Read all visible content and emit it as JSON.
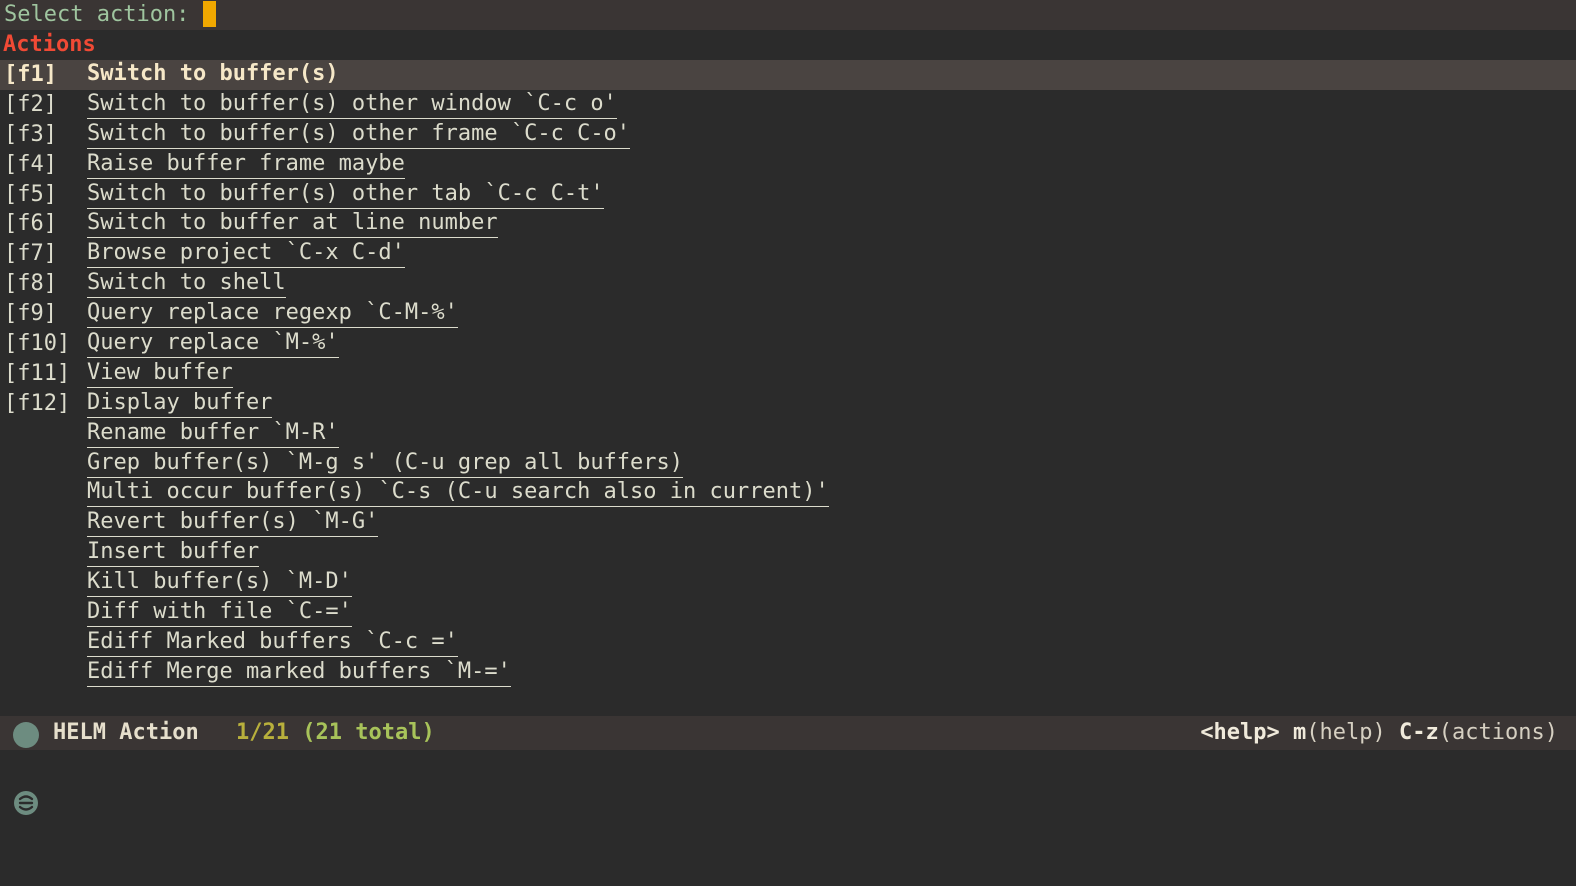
{
  "prompt": {
    "label": "Select action: "
  },
  "header": {
    "title": "Actions"
  },
  "actions": [
    {
      "key": "[f1]",
      "label": "Switch to buffer(s)"
    },
    {
      "key": "[f2]",
      "label": "Switch to buffer(s) other window `C-c o'"
    },
    {
      "key": "[f3]",
      "label": "Switch to buffer(s) other frame `C-c C-o'"
    },
    {
      "key": "[f4]",
      "label": "Raise buffer frame maybe"
    },
    {
      "key": "[f5]",
      "label": "Switch to buffer(s) other tab `C-c C-t'"
    },
    {
      "key": "[f6]",
      "label": "Switch to buffer at line number"
    },
    {
      "key": "[f7]",
      "label": "Browse project `C-x C-d'"
    },
    {
      "key": "[f8]",
      "label": "Switch to shell"
    },
    {
      "key": "[f9]",
      "label": "Query replace regexp `C-M-%'"
    },
    {
      "key": "[f10]",
      "label": "Query replace `M-%'"
    },
    {
      "key": "[f11]",
      "label": "View buffer"
    },
    {
      "key": "[f12]",
      "label": "Display buffer"
    },
    {
      "key": "",
      "label": "Rename buffer `M-R'"
    },
    {
      "key": "",
      "label": "Grep buffer(s) `M-g s' (C-u grep all buffers)"
    },
    {
      "key": "",
      "label": "Multi occur buffer(s) `C-s (C-u search also in current)'"
    },
    {
      "key": "",
      "label": "Revert buffer(s) `M-G'"
    },
    {
      "key": "",
      "label": "Insert buffer"
    },
    {
      "key": "",
      "label": "Kill buffer(s) `M-D'"
    },
    {
      "key": "",
      "label": "Diff with file `C-='"
    },
    {
      "key": "",
      "label": "Ediff Marked buffers `C-c ='"
    },
    {
      "key": "",
      "label": "Ediff Merge marked buffers `M-='"
    }
  ],
  "modeline": {
    "icon": "helm-logo-icon",
    "name": "HELM Action",
    "count_current": "1/21",
    "count_total": "(21 total)",
    "help_key": "<help>",
    "help_m": "m",
    "help_label": "(help)",
    "actions_key": "C-z",
    "actions_label": "(actions)"
  },
  "colors": {
    "background": "#2b2b2b",
    "header": "#f04a35",
    "cursor": "#f0a800",
    "selected_row": "#4a4441",
    "count": "#a8c35a"
  }
}
